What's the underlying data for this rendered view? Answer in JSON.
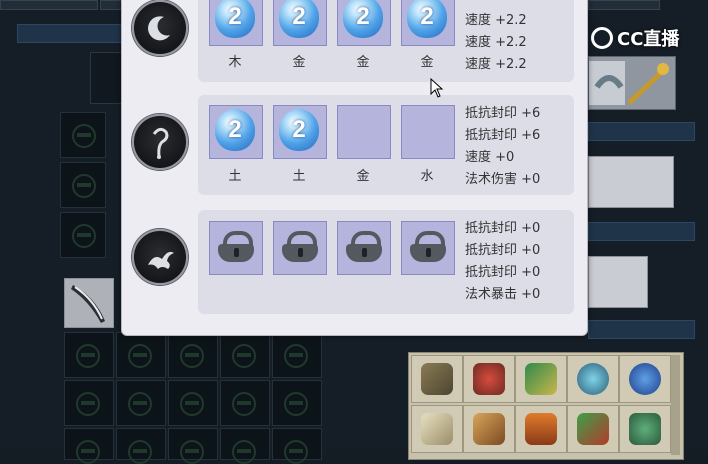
{
  "watermark": {
    "brand": "CC直播"
  },
  "rows": [
    {
      "circle_icon": "crescent-moon-icon",
      "slots": [
        {
          "filled": true,
          "num": "2",
          "label": "木"
        },
        {
          "filled": true,
          "num": "2",
          "label": "金"
        },
        {
          "filled": true,
          "num": "2",
          "label": "金"
        },
        {
          "filled": true,
          "num": "2",
          "label": "金"
        }
      ],
      "stats": [
        "速度 +2.2",
        "速度 +2.2",
        "速度 +2.2"
      ]
    },
    {
      "circle_icon": "hook-icon",
      "slots": [
        {
          "filled": true,
          "num": "2",
          "label": "土"
        },
        {
          "filled": true,
          "num": "2",
          "label": "土"
        },
        {
          "filled": false,
          "num": "",
          "label": "金"
        },
        {
          "filled": false,
          "num": "",
          "label": "水"
        }
      ],
      "stats": [
        "抵抗封印 +6",
        "抵抗封印 +6",
        "速度 +0",
        "法术伤害 +0"
      ]
    },
    {
      "circle_icon": "dragon-icon",
      "slots": [
        {
          "locked": true,
          "label": ""
        },
        {
          "locked": true,
          "label": ""
        },
        {
          "locked": true,
          "label": ""
        },
        {
          "locked": true,
          "label": ""
        }
      ],
      "stats": [
        "抵抗封印 +0",
        "抵抗封印 +0",
        "抵抗封印 +0",
        "法术暴击 +0"
      ]
    }
  ],
  "inventory_icons": [
    "arrow-icon",
    "doll-icon",
    "map-icon",
    "orb-icon",
    "shield-icon",
    "scroll-icon",
    "book-icon",
    "pagoda-icon",
    "fan-icon",
    "cauldron-icon"
  ]
}
